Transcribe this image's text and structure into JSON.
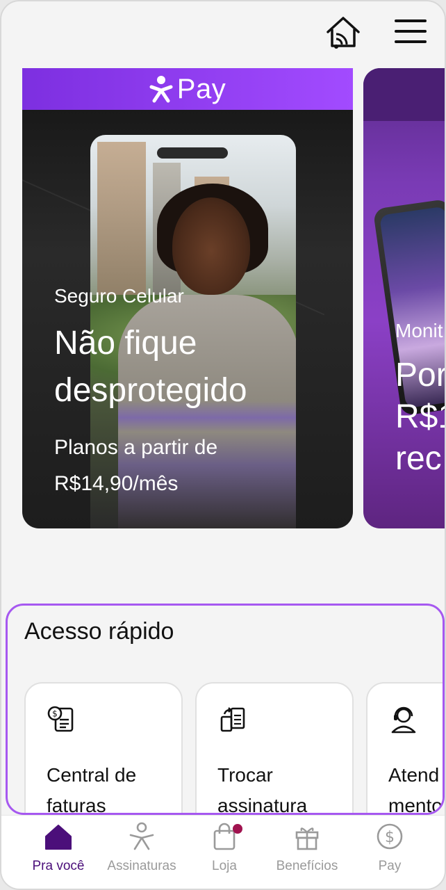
{
  "header": {
    "home_icon": "home-wifi-icon",
    "menu_icon": "hamburger-menu-icon"
  },
  "carousel": {
    "cards": [
      {
        "brand": "Pay",
        "subtitle": "Seguro Celular",
        "title": "Não fique desprotegido",
        "price_text": "Planos a partir de R$14,90/mês",
        "accent_color": "#9a45f5"
      },
      {
        "subtitle": "Monit",
        "title": "Por\nR$1\nrec"
      }
    ]
  },
  "quick_access": {
    "title": "Acesso rápido",
    "items": [
      {
        "label": "Central de\nfaturas",
        "icon": "invoice-icon"
      },
      {
        "label": "Trocar\nassinatura",
        "icon": "swap-documents-icon"
      },
      {
        "label": "Atend\nmento",
        "icon": "support-headset-icon"
      }
    ],
    "border_color": "#a658f0"
  },
  "bottom_nav": {
    "items": [
      {
        "label": "Pra você",
        "icon": "home-icon",
        "active": true
      },
      {
        "label": "Assinaturas",
        "icon": "person-icon",
        "active": false
      },
      {
        "label": "Loja",
        "icon": "shopping-bag-icon",
        "active": false
      },
      {
        "label": "Benefícios",
        "icon": "gift-icon",
        "active": false
      },
      {
        "label": "Pay",
        "icon": "dollar-coin-icon",
        "active": false
      }
    ],
    "active_color": "#4b0f7a",
    "badge_color": "#a0134f"
  }
}
